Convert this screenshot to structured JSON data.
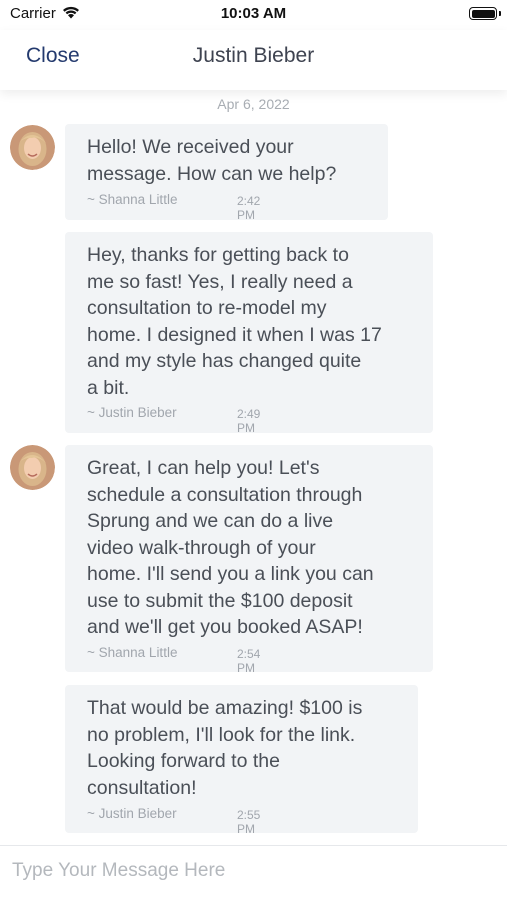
{
  "status": {
    "carrier": "Carrier",
    "time": "10:03 AM",
    "battery_level": 1.0
  },
  "nav": {
    "close_label": "Close",
    "title": "Justin Bieber"
  },
  "chat": {
    "date": "Apr 6, 2022",
    "messages": [
      {
        "text": "Hello!  We received your\nmessage.  How can we help?",
        "sender": "~ Shanna Little",
        "time": "2:42 PM",
        "has_avatar": true
      },
      {
        "text": "Hey, thanks for getting back to\nme so fast!  Yes, I really need a\nconsultation to re-model my\nhome.  I designed it when I was 17\nand my style has changed quite\na bit.",
        "sender": "~ Justin Bieber",
        "time": "2:49 PM",
        "has_avatar": false
      },
      {
        "text": "Great, I can help you!  Let's\nschedule a consultation through\nSprung and we can do a live\nvideo walk-through of your\nhome.  I'll send you a link you can\nuse to submit the $100 deposit\nand we'll get you booked ASAP!",
        "sender": "~ Shanna Little",
        "time": "2:54 PM",
        "has_avatar": true
      },
      {
        "text": "That would be amazing!  $100 is\nno problem, I'll look for the link.\nLooking forward to the\nconsultation!",
        "sender": "~ Justin Bieber",
        "time": "2:55 PM",
        "has_avatar": false
      }
    ]
  },
  "composer": {
    "placeholder": "Type Your Message Here",
    "value": ""
  }
}
